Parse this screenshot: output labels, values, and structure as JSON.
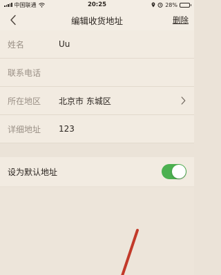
{
  "status": {
    "carrier": "中国联通",
    "time": "20:25",
    "battery": "28%",
    "battery_level": 0.28
  },
  "nav": {
    "title": "编辑收货地址",
    "delete_label": "删除"
  },
  "form": {
    "name": {
      "label": "姓名",
      "value": "Uu"
    },
    "phone": {
      "label": "联系电话",
      "value": ""
    },
    "region": {
      "label": "所在地区",
      "value": "北京市 东城区"
    },
    "detail": {
      "label": "详细地址",
      "value": "123"
    }
  },
  "default_address": {
    "label": "设为默认地址",
    "enabled": true
  },
  "colors": {
    "toggle_on": "#4cb050",
    "marker": "#c23a2a"
  }
}
